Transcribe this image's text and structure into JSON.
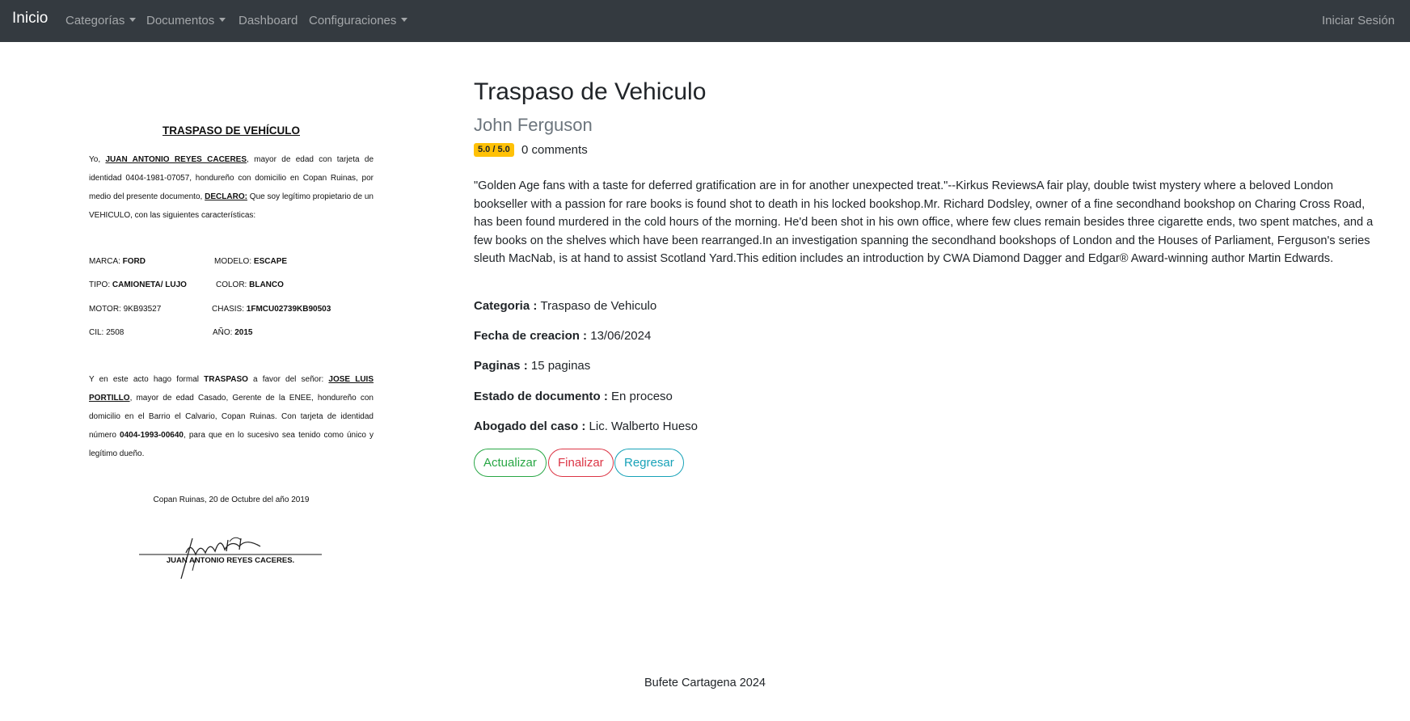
{
  "navbar": {
    "brand": "Inicio",
    "items": [
      {
        "label": "Categorías",
        "dropdown": true
      },
      {
        "label": "Documentos",
        "dropdown": true
      },
      {
        "label": "Dashboard",
        "dropdown": false
      },
      {
        "label": "Configuraciones",
        "dropdown": true
      }
    ],
    "login": "Iniciar Sesión"
  },
  "document_image": {
    "title": "TRASPASO DE VEHÍCULO",
    "para1": {
      "intro": "Yo, ",
      "name": "JUAN ANTONIO REYES  CACERES",
      "text1": ", mayor de edad con tarjeta de identidad 0404-1981-07057, hondureño con domicilio en Copan Ruinas, por medio del presente documento, ",
      "declaro": "DECLARO:",
      "text2": " Que soy legítimo propietario de un VEHICULO, con las siguientes características:"
    },
    "fields": [
      {
        "label": "MARCA: ",
        "value": "FORD"
      },
      {
        "label": "MODELO: ",
        "value": "ESCAPE"
      },
      {
        "label": "TIPO: ",
        "value": "CAMIONETA/ LUJO"
      },
      {
        "label": "COLOR: ",
        "value": "BLANCO"
      },
      {
        "label": "MOTOR: ",
        "value": "9KB93527"
      },
      {
        "label": "CHASIS: ",
        "value": "1FMCU02739KB90503"
      },
      {
        "label": "CIL: ",
        "value": "2508"
      },
      {
        "label": "AÑO: ",
        "value": "2015"
      }
    ],
    "para2": {
      "text1": "Y en este acto hago formal ",
      "traspaso": "TRASPASO",
      "text2": " a favor del señor: ",
      "buyer": "JOSE LUIS PORTILLO",
      "text3": ", mayor de edad Casado, Gerente de la ENEE, hondureño con domicilio en el Barrio el Calvario, Copan Ruinas. Con tarjeta de identidad número ",
      "id": "0404-1993-00640",
      "text4": ", para que en lo sucesivo sea tenido como único y legítimo dueño."
    },
    "place_date": "Copan Ruinas, 20 de Octubre del año 2019",
    "signature_name": "JUAN ANTONIO REYES CACERES."
  },
  "detail": {
    "title": "Traspaso de Vehiculo",
    "author": "John Ferguson",
    "rating": "5.0 / 5.0",
    "comments": "0 comments",
    "description": "\"Golden Age fans with a taste for deferred gratification are in for another unexpected treat.\"--Kirkus ReviewsA fair play, double twist mystery where a beloved London bookseller with a passion for rare books is found shot to death in his locked bookshop.Mr. Richard Dodsley, owner of a fine secondhand bookshop on Charing Cross Road, has been found murdered in the cold hours of the morning. He'd been shot in his own office, where few clues remain besides three cigarette ends, two spent matches, and a few books on the shelves which have been rearranged.In an investigation spanning the secondhand bookshops of London and the Houses of Parliament, Ferguson's series sleuth MacNab, is at hand to assist Scotland Yard.This edition includes an introduction by CWA Diamond Dagger and Edgar® Award-winning author Martin Edwards.",
    "fields": [
      {
        "label": "Categoria : ",
        "value": "Traspaso de Vehiculo"
      },
      {
        "label": "Fecha de creacion : ",
        "value": "13/06/2024"
      },
      {
        "label": "Paginas : ",
        "value": "15 paginas"
      },
      {
        "label": "Estado de documento : ",
        "value": "En proceso"
      },
      {
        "label": "Abogado del caso : ",
        "value": "Lic. Walberto Hueso"
      }
    ],
    "buttons": {
      "update": "Actualizar",
      "finish": "Finalizar",
      "back": "Regresar"
    }
  },
  "footer": "Bufete Cartagena 2024",
  "colors": {
    "navbar": "#343a40",
    "badge": "#ffc107",
    "success": "#28a745",
    "danger": "#dc3545",
    "info": "#17a2b8"
  }
}
